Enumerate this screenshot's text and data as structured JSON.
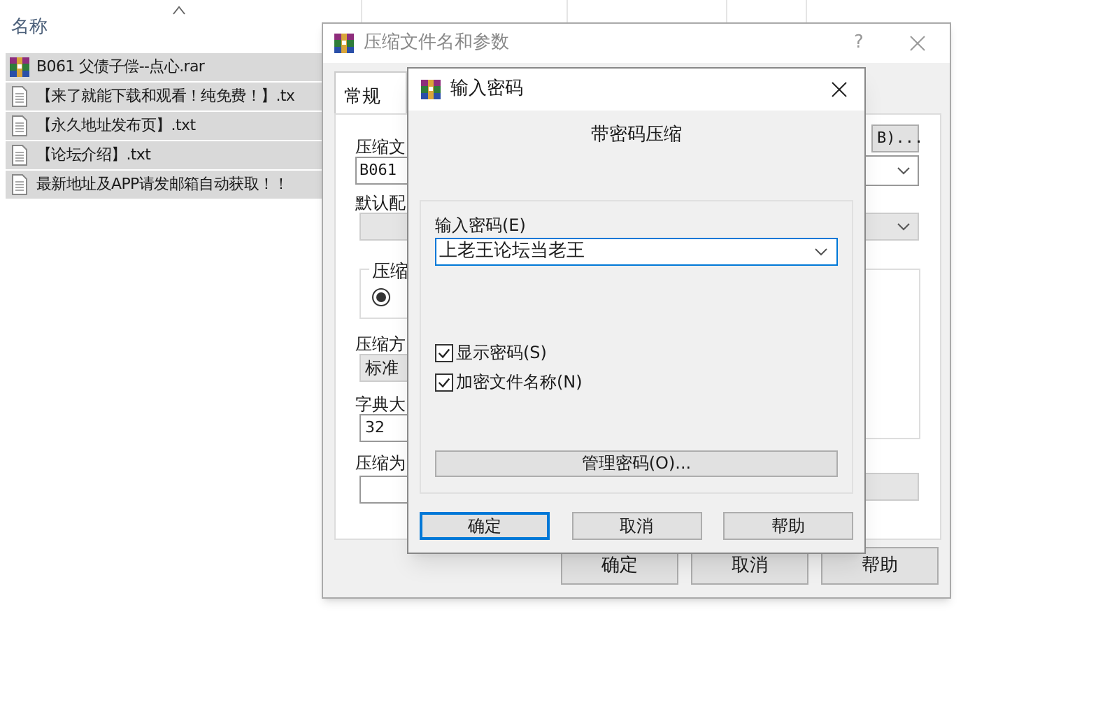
{
  "explorer": {
    "column": "名称",
    "files": [
      {
        "name": "B061 父债子偿--点心.rar",
        "kind": "archive",
        "selected": true
      },
      {
        "name": "【来了就能下载和观看！纯免费！】.tx",
        "kind": "text",
        "selected": true
      },
      {
        "name": "【永久地址发布页】.txt",
        "kind": "text",
        "selected": true
      },
      {
        "name": "【论坛介绍】.txt",
        "kind": "text",
        "selected": true
      },
      {
        "name": "最新地址及APP请发邮箱自动获取！！",
        "kind": "text",
        "selected": true
      }
    ]
  },
  "archive_dialog": {
    "title": "压缩文件名和参数",
    "help": "?",
    "tabs": [
      {
        "label": "常规",
        "selected": true
      }
    ],
    "archive_name_label": "压缩文",
    "archive_name_value": "B061",
    "browse_button": "B)...",
    "profile_label": "默认配",
    "group_label": "压缩",
    "radio_checked": true,
    "method_label": "压缩方",
    "method_value": "标准",
    "dict_label": "字典大",
    "dict_value": "32",
    "split_label": "压缩为",
    "buttons": [
      {
        "label": "确定"
      },
      {
        "label": "取消"
      },
      {
        "label": "帮助"
      }
    ]
  },
  "password_dialog": {
    "title": "输入密码",
    "heading": "带密码压缩",
    "password_label": "输入密码(E)",
    "password_value": "上老王论坛当老王",
    "options": [
      {
        "label": "显示密码(S)",
        "checked": true
      },
      {
        "label": "加密文件名称(N)",
        "checked": true
      }
    ],
    "manage_button": "管理密码(O)...",
    "buttons": [
      {
        "label": "确定",
        "default": true
      },
      {
        "label": "取消",
        "default": false
      },
      {
        "label": "帮助",
        "default": false
      }
    ]
  }
}
